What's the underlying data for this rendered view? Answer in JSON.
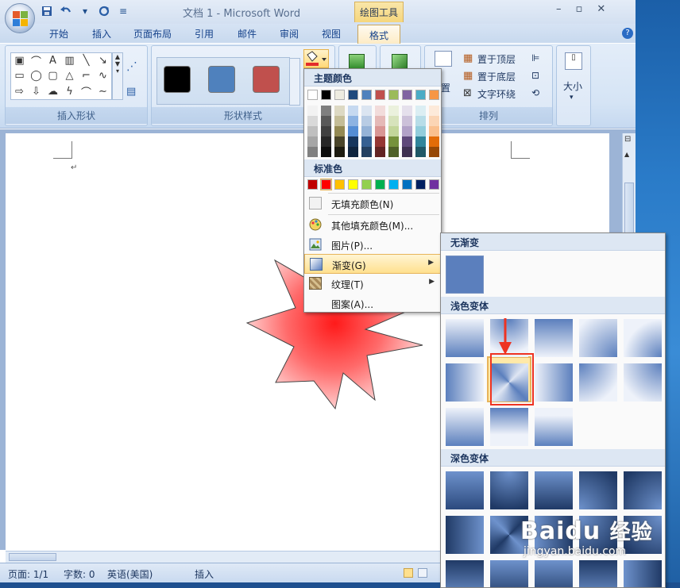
{
  "window": {
    "title": "文档 1 - Microsoft Word",
    "contextual_tab_group": "绘图工具"
  },
  "tabs": [
    {
      "label": "开始"
    },
    {
      "label": "插入"
    },
    {
      "label": "页面布局"
    },
    {
      "label": "引用"
    },
    {
      "label": "邮件"
    },
    {
      "label": "审阅"
    },
    {
      "label": "视图"
    },
    {
      "label": "格式",
      "active": true
    }
  ],
  "ribbon": {
    "groups": {
      "insert_shapes": "插入形状",
      "shape_styles": "形状样式",
      "arrange": "排列",
      "size": "大小"
    },
    "arrange": {
      "bring_front": "置于顶层",
      "send_back": "置于底层",
      "text_wrap": "文字环绕",
      "position_fragment": "置"
    },
    "style_swatches": [
      "#000000",
      "#4f81bd",
      "#c0504d"
    ]
  },
  "fill_menu": {
    "theme_header": "主题颜色",
    "standard_header": "标准色",
    "theme_colors": [
      "#ffffff",
      "#000000",
      "#eeece1",
      "#1f497d",
      "#4f81bd",
      "#c0504d",
      "#9bbb59",
      "#8064a2",
      "#4bacc6",
      "#f79646"
    ],
    "shades": [
      [
        "#f2f2f2",
        "#d9d9d9",
        "#bfbfbf",
        "#a6a6a6",
        "#808080"
      ],
      [
        "#7f7f7f",
        "#595959",
        "#404040",
        "#262626",
        "#0d0d0d"
      ],
      [
        "#ddd9c3",
        "#c4bd97",
        "#948a54",
        "#4a452a",
        "#1d1b10"
      ],
      [
        "#c6d9f0",
        "#8db3e2",
        "#548dd4",
        "#17365d",
        "#0f243e"
      ],
      [
        "#dbe5f1",
        "#b8cce4",
        "#95b3d7",
        "#366092",
        "#244061"
      ],
      [
        "#f2dcdb",
        "#e5b9b7",
        "#d99694",
        "#953734",
        "#632423"
      ],
      [
        "#ebf1dd",
        "#d7e3bc",
        "#c3d69b",
        "#76923c",
        "#4f6128"
      ],
      [
        "#e5e0ec",
        "#ccc1d9",
        "#b2a2c7",
        "#5f497a",
        "#3f3151"
      ],
      [
        "#dbeef3",
        "#b7dde8",
        "#92cddc",
        "#31859b",
        "#205867"
      ],
      [
        "#fdeada",
        "#fbd5b5",
        "#fac08f",
        "#e36c09",
        "#974806"
      ]
    ],
    "standard_colors": [
      "#c00000",
      "#ff0000",
      "#ffc000",
      "#ffff00",
      "#92d050",
      "#00b050",
      "#00b0f0",
      "#0070c0",
      "#002060",
      "#7030a0"
    ],
    "items": [
      {
        "label": "无填充颜色(N)",
        "icon": "no-fill-icon"
      },
      {
        "label": "其他填充颜色(M)...",
        "icon": "palette-icon"
      },
      {
        "label": "图片(P)...",
        "icon": "picture-icon"
      },
      {
        "label": "渐变(G)",
        "icon": "gradient-icon",
        "has_submenu": true,
        "highlighted": true
      },
      {
        "label": "纹理(T)",
        "icon": "texture-icon",
        "has_submenu": true
      },
      {
        "label": "图案(A)...",
        "icon": ""
      }
    ]
  },
  "gradient_submenu": {
    "no_gradient": "无渐变",
    "light_variants": "浅色变体",
    "dark_variants": "深色变体",
    "light_count": 13,
    "dark_count": 15,
    "selected_light_index": 6
  },
  "status_bar": {
    "page": "页面: 1/1",
    "words": "字数: 0",
    "language": "英语(美国)",
    "mode": "插入"
  },
  "watermark": {
    "brand": "Baidu",
    "cn": "经验",
    "url": "jingyan.baidu.com"
  },
  "icons": {
    "save": "save-icon",
    "undo": "undo-icon",
    "redo": "redo-icon",
    "help": "help-icon"
  }
}
